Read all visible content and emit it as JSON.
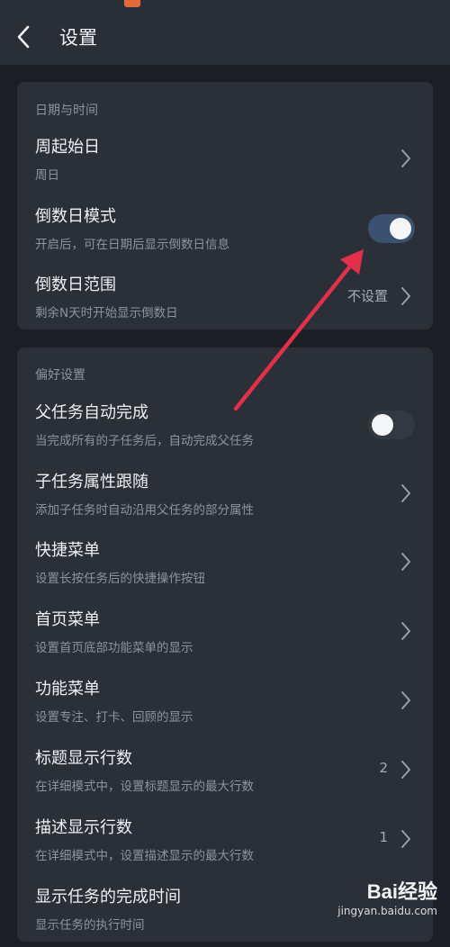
{
  "header": {
    "title": "设置"
  },
  "date_section": {
    "label": "日期与时间",
    "items": [
      {
        "title": "周起始日",
        "subtitle": "周日",
        "value": "",
        "control": "chevron"
      },
      {
        "title": "倒数日模式",
        "subtitle": "开启后，可在日期后显示倒数日信息",
        "value": "",
        "control": "toggle",
        "on": true
      },
      {
        "title": "倒数日范围",
        "subtitle": "剩余N天时开始显示倒数日",
        "value": "不设置",
        "control": "chevron"
      }
    ]
  },
  "pref_section": {
    "label": "偏好设置",
    "items": [
      {
        "title": "父任务自动完成",
        "subtitle": "当完成所有的子任务后，自动完成父任务",
        "value": "",
        "control": "toggle",
        "on": false
      },
      {
        "title": "子任务属性跟随",
        "subtitle": "添加子任务时自动沿用父任务的部分属性",
        "value": "",
        "control": "chevron"
      },
      {
        "title": "快捷菜单",
        "subtitle": "设置长按任务后的快捷操作按钮",
        "value": "",
        "control": "chevron"
      },
      {
        "title": "首页菜单",
        "subtitle": "设置首页底部功能菜单的显示",
        "value": "",
        "control": "chevron"
      },
      {
        "title": "功能菜单",
        "subtitle": "设置专注、打卡、回顾的显示",
        "value": "",
        "control": "chevron"
      },
      {
        "title": "标题显示行数",
        "subtitle": "在详细模式中，设置标题显示的最大行数",
        "value": "2",
        "control": "chevron"
      },
      {
        "title": "描述显示行数",
        "subtitle": "在详细模式中，设置描述显示的最大行数",
        "value": "1",
        "control": "chevron"
      },
      {
        "title": "显示任务的完成时间",
        "subtitle": "显示任务的执行时间",
        "value": "",
        "control": "none"
      }
    ]
  },
  "watermark": {
    "brand": "Bai经验",
    "url": "jingyan.baidu.com"
  },
  "colors": {
    "arrow": "#e3304a",
    "toggle_on": "#3a5170",
    "background": "#1b1f25",
    "card": "#2b3038"
  }
}
